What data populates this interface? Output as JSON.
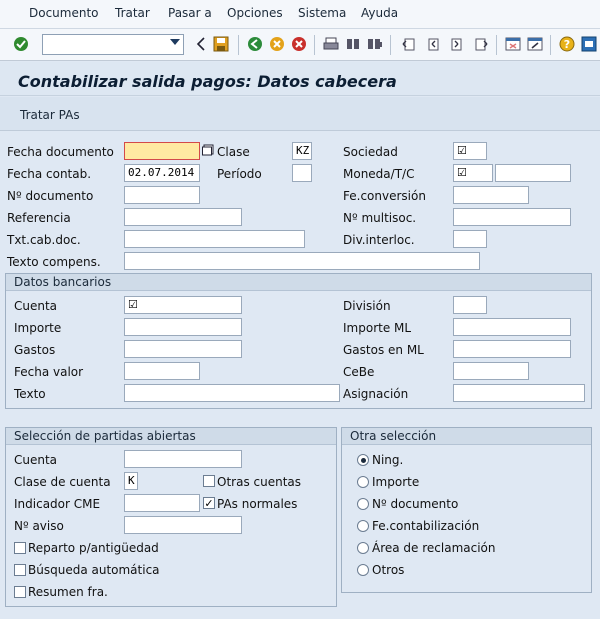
{
  "menu": {
    "items": [
      {
        "label": "Documento"
      },
      {
        "label": "Tratar"
      },
      {
        "label": "Pasar a"
      },
      {
        "label": "Opciones"
      },
      {
        "label": "Sistema"
      },
      {
        "label": "Ayuda"
      }
    ]
  },
  "toolbar": {
    "command_value": ""
  },
  "title": "Contabilizar salida pagos: Datos cabecera",
  "app_toolbar": {
    "tratar_label": "Tratar PAs"
  },
  "header": {
    "fecha_documento_label": "Fecha documento",
    "fecha_documento_value": "",
    "clase_label": "Clase",
    "clase_value": "KZ",
    "sociedad_label": "Sociedad",
    "sociedad_value": "☑",
    "fecha_contab_label": "Fecha contab.",
    "fecha_contab_value": "02.07.2014",
    "periodo_label": "Período",
    "periodo_value": "",
    "moneda_label": "Moneda/T/C",
    "moneda_value": "☑",
    "tc_value": "",
    "num_documento_label": "Nº documento",
    "num_documento_value": "",
    "fe_conversion_label": "Fe.conversión",
    "fe_conversion_value": "",
    "referencia_label": "Referencia",
    "referencia_value": "",
    "num_multisoc_label": "Nº multisoc.",
    "num_multisoc_value": "",
    "txt_cab_doc_label": "Txt.cab.doc.",
    "txt_cab_doc_value": "",
    "div_interloc_label": "Div.interloc.",
    "div_interloc_value": "",
    "texto_compens_label": "Texto compens.",
    "texto_compens_value": ""
  },
  "datos_bancarios": {
    "title": "Datos bancarios",
    "cuenta_label": "Cuenta",
    "cuenta_value": "☑",
    "division_label": "División",
    "division_value": "",
    "importe_label": "Importe",
    "importe_value": "",
    "importe_ml_label": "Importe ML",
    "importe_ml_value": "",
    "gastos_label": "Gastos",
    "gastos_value": "",
    "gastos_ml_label": "Gastos en ML",
    "gastos_ml_value": "",
    "fecha_valor_label": "Fecha valor",
    "fecha_valor_value": "",
    "cebe_label": "CeBe",
    "cebe_value": "",
    "texto_label": "Texto",
    "texto_value": "",
    "asignacion_label": "Asignación",
    "asignacion_value": ""
  },
  "seleccion": {
    "title": "Selección de partidas abiertas",
    "cuenta_label": "Cuenta",
    "cuenta_value": "",
    "clase_cuenta_label": "Clase de cuenta",
    "clase_cuenta_value": "K",
    "otras_cuentas_label": "Otras cuentas",
    "otras_cuentas_checked": false,
    "indicador_cme_label": "Indicador CME",
    "indicador_cme_value": "",
    "pas_normales_label": "PAs normales",
    "pas_normales_checked": true,
    "num_aviso_label": "Nº aviso",
    "num_aviso_value": "",
    "reparto_label": "Reparto p/antigüedad",
    "busqueda_label": "Búsqueda automática",
    "resumen_label": "Resumen fra."
  },
  "otra_seleccion": {
    "title": "Otra selección",
    "options": [
      {
        "label": "Ning.",
        "selected": true
      },
      {
        "label": "Importe",
        "selected": false
      },
      {
        "label": "Nº documento",
        "selected": false
      },
      {
        "label": "Fe.contabilización",
        "selected": false
      },
      {
        "label": "Área de reclamación",
        "selected": false
      },
      {
        "label": "Otros",
        "selected": false
      }
    ]
  }
}
